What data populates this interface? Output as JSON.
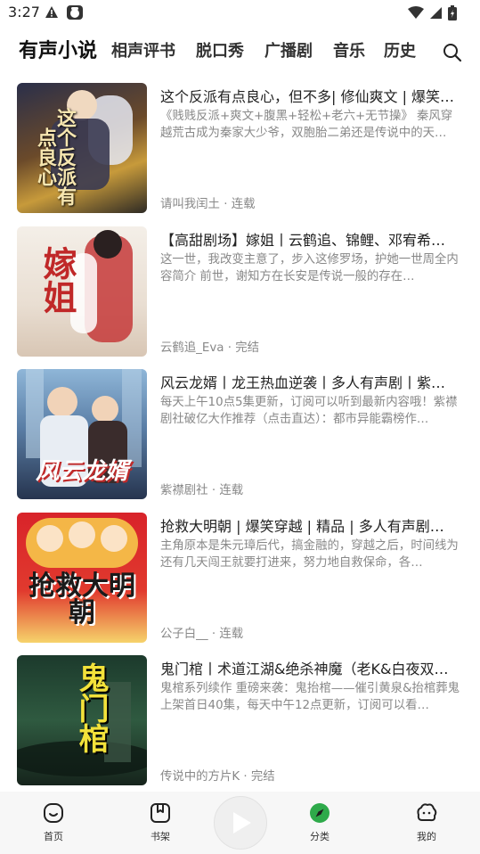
{
  "status_bar": {
    "time": "3:27"
  },
  "tabs": [
    {
      "label": "有声小说",
      "active": true
    },
    {
      "label": "相声评书"
    },
    {
      "label": "脱口秀"
    },
    {
      "label": "广播剧"
    },
    {
      "label": "音乐"
    },
    {
      "label": "历史"
    }
  ],
  "items": [
    {
      "title": "这个反派有点良心，但不多| 修仙爽文 | 爆笑…",
      "desc": "《贱贱反派+爽文+腹黑+轻松+老六+无节操》 秦风穿越荒古成为秦家大少爷，双胞胎二弟还是传说中的天…",
      "author": "请叫我闰土",
      "status": "连载",
      "cover_text": "这个反派有点良心"
    },
    {
      "title": "【高甜剧场】嫁姐丨云鹤追、锦鲤、邓宥希…",
      "desc": "这一世，我改变主意了，步入这修罗场，护她一世周全内容简介 前世，谢知方在长安是传说一般的存在…",
      "author": "云鹤追_Eva",
      "status": "完结",
      "cover_text": "嫁姐"
    },
    {
      "title": "风云龙婿丨龙王热血逆袭丨多人有声剧丨紫…",
      "desc": "每天上午10点5集更新，订阅可以听到最新内容哦！紫襟剧社破亿大作推荐（点击直达）：都市异能霸榜作…",
      "author": "紫襟剧社",
      "status": "连载",
      "cover_text": "风云龙婿"
    },
    {
      "title": "抢救大明朝 | 爆笑穿越 | 精品 | 多人有声剧…",
      "desc": "主角原本是朱元璋后代，搞金融的，穿越之后，时间线为还有几天闯王就要打进来，努力地自救保命，各…",
      "author": "公子白__",
      "status": "连载",
      "cover_text": "抢救大明朝"
    },
    {
      "title": "鬼门棺丨术道江湖&绝杀神魔（老K&白夜双…",
      "desc": "鬼棺系列续作 重磅来袭：鬼抬棺——催引黄泉&抬棺葬鬼上架首日40集，每天中午12点更新，订阅可以看…",
      "author": "传说中的方片K",
      "status": "完结",
      "cover_text": "鬼门棺"
    }
  ],
  "bottom_nav": [
    {
      "label": "首页",
      "icon": "home-icon"
    },
    {
      "label": "书架",
      "icon": "bookshelf-icon"
    },
    {
      "label": "分类",
      "icon": "category-icon",
      "color": "#2eaa4a"
    },
    {
      "label": "我的",
      "icon": "profile-icon"
    }
  ],
  "colors": {
    "accent_green": "#2eaa4a",
    "meta_gray": "#888888",
    "nav_bg": "#f7f7f7"
  }
}
